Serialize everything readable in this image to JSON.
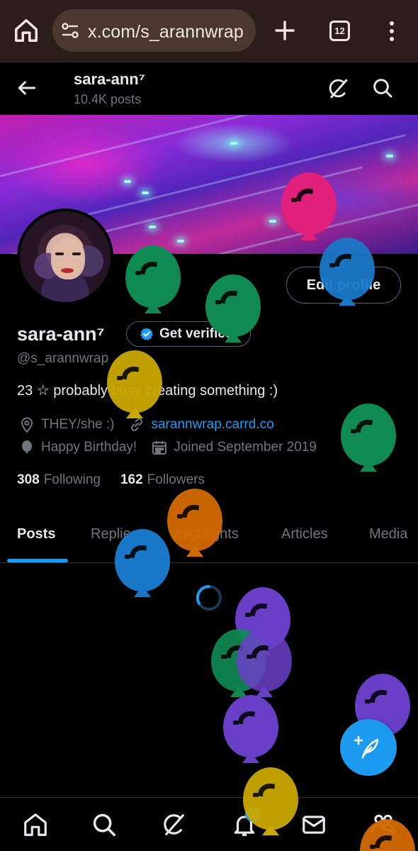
{
  "browser": {
    "url": "x.com/s_arannwrap",
    "tab_count": "12"
  },
  "header": {
    "name": "sara-ann⁷",
    "posts": "10.4K posts"
  },
  "profile": {
    "edit_label": "Edit profile",
    "display_name": "sara-ann⁷",
    "verify_label": "Get verified",
    "handle": "@s_arannwrap",
    "bio": "23 ☆ probably busy creating something :)",
    "location": "THEY/she :)",
    "website": "sarannwrap.carrd.co",
    "birthday": "Happy Birthday!",
    "joined": "Joined September 2019",
    "following_count": "308",
    "following_label": "Following",
    "followers_count": "162",
    "followers_label": "Followers"
  },
  "tabs": [
    {
      "label": "Posts",
      "active": true
    },
    {
      "label": "Replies"
    },
    {
      "label": "Highlights"
    },
    {
      "label": "Articles"
    },
    {
      "label": "Media"
    }
  ],
  "nav": {
    "notification_badge": "1",
    "items": [
      "home-icon",
      "search-icon",
      "grok-icon",
      "notifications-icon",
      "messages-icon",
      "communities-icon"
    ]
  },
  "colors": {
    "accent": "#1d9bf0",
    "background": "#000000",
    "browser_bar": "#2b1d17",
    "balloon_green": "#0f8a52",
    "balloon_pink": "#e0207a",
    "balloon_blue": "#1a78c8",
    "balloon_yellow": "#c9a800",
    "balloon_orange": "#d36a00",
    "balloon_purple": "#6a3fc8"
  }
}
